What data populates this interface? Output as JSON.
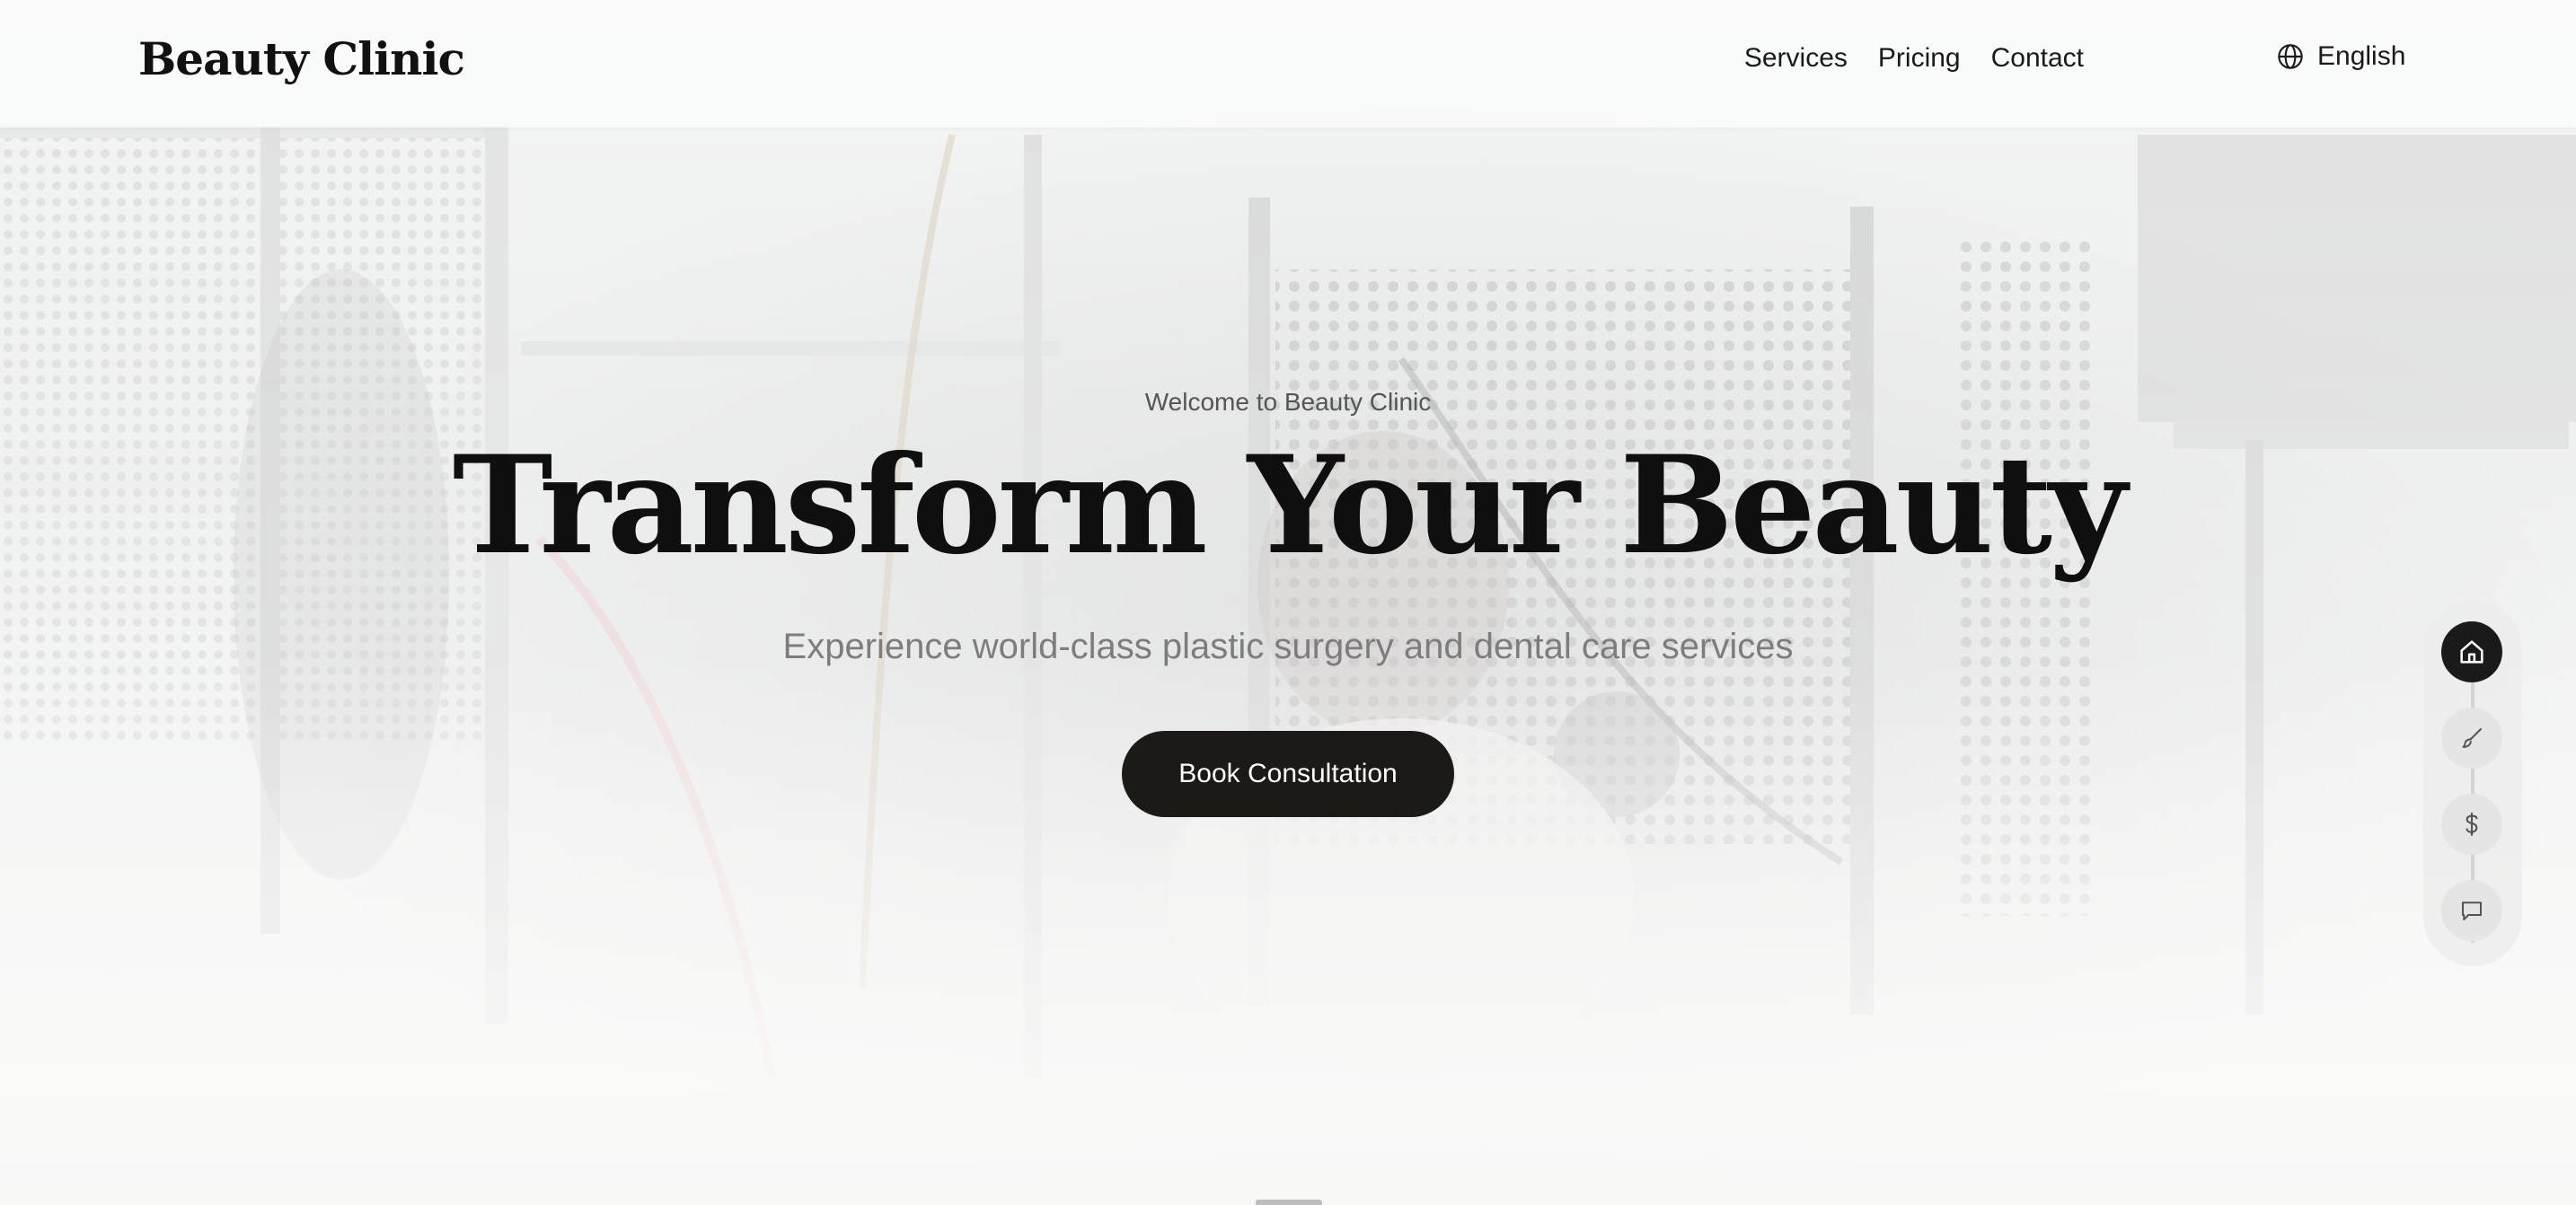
{
  "header": {
    "logo": "Beauty Clinic",
    "nav": [
      {
        "label": "Services"
      },
      {
        "label": "Pricing"
      },
      {
        "label": "Contact"
      }
    ],
    "language": {
      "label": "English",
      "icon": "globe-icon"
    }
  },
  "hero": {
    "welcome": "Welcome to Beauty Clinic",
    "headline": "Transform Your Beauty",
    "subline": "Experience world-class plastic surgery and dental care services",
    "cta_label": "Book Consultation"
  },
  "side_nav": {
    "items": [
      {
        "icon": "home-icon",
        "active": true
      },
      {
        "icon": "brush-icon",
        "active": false
      },
      {
        "icon": "dollar-icon",
        "active": false
      },
      {
        "icon": "chat-icon",
        "active": false
      }
    ]
  },
  "colors": {
    "primary": "#1c1a17",
    "text": "#111111",
    "muted": "#7d7d7d"
  }
}
